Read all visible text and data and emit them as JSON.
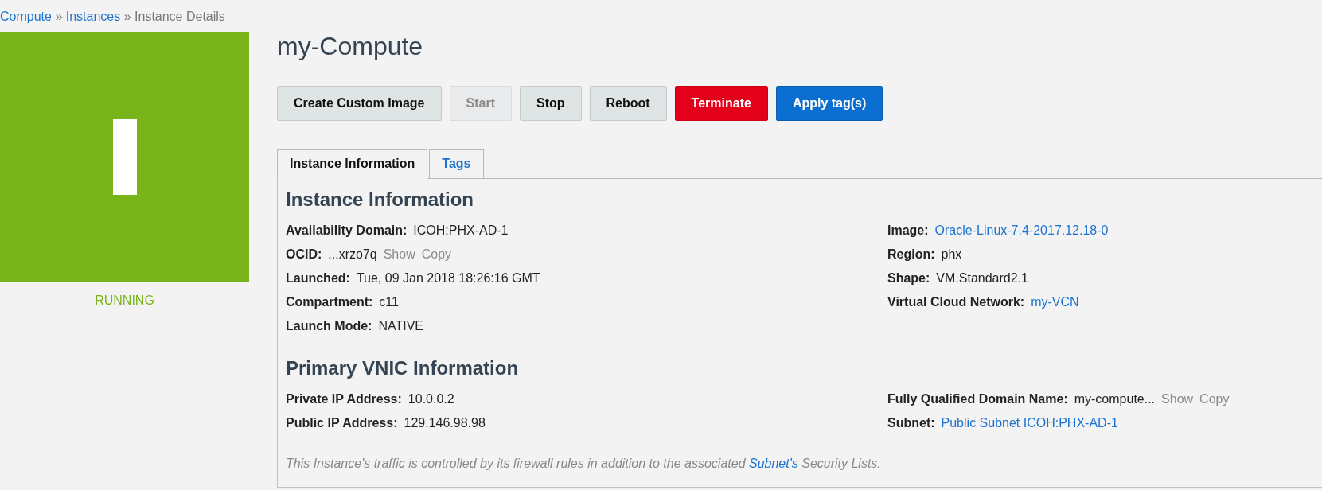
{
  "breadcrumb": {
    "separator": "»",
    "items": [
      {
        "label": "Compute",
        "kind": "link"
      },
      {
        "label": "Instances",
        "kind": "link"
      },
      {
        "label": "Instance Details",
        "kind": "current"
      }
    ]
  },
  "status": {
    "label": "RUNNING"
  },
  "title": "my-Compute",
  "buttons": [
    {
      "label": "Create Custom Image",
      "kind": "default",
      "disabled": false
    },
    {
      "label": "Start",
      "kind": "default",
      "disabled": true
    },
    {
      "label": "Stop",
      "kind": "default",
      "disabled": false
    },
    {
      "label": "Reboot",
      "kind": "default",
      "disabled": false
    },
    {
      "label": "Terminate",
      "kind": "danger",
      "disabled": false
    },
    {
      "label": "Apply tag(s)",
      "kind": "primary",
      "disabled": false
    }
  ],
  "tabs": [
    {
      "label": "Instance Information",
      "selected": true
    },
    {
      "label": "Tags",
      "selected": false
    }
  ],
  "sections": [
    {
      "heading": "Instance Information",
      "left": [
        {
          "label": "Availability Domain:",
          "value": "ICOH:PHX-AD-1",
          "kind": "text"
        },
        {
          "label": "OCID:",
          "value": "...xrzo7q",
          "kind": "secret",
          "actions": [
            "Show",
            "Copy"
          ]
        },
        {
          "label": "Launched:",
          "value": "Tue, 09 Jan 2018 18:26:16 GMT",
          "kind": "text"
        },
        {
          "label": "Compartment:",
          "value": "c11",
          "kind": "text"
        },
        {
          "label": "Launch Mode:",
          "value": "NATIVE",
          "kind": "text"
        }
      ],
      "right": [
        {
          "label": "Image:",
          "value": "Oracle-Linux-7.4-2017.12.18-0",
          "kind": "link"
        },
        {
          "label": "Region:",
          "value": "phx",
          "kind": "text"
        },
        {
          "label": "Shape:",
          "value": "VM.Standard2.1",
          "kind": "text"
        },
        {
          "label": "Virtual Cloud Network:",
          "value": "my-VCN",
          "kind": "link"
        }
      ]
    },
    {
      "heading": "Primary VNIC Information",
      "left": [
        {
          "label": "Private IP Address:",
          "value": "10.0.0.2",
          "kind": "text"
        },
        {
          "label": "Public IP Address:",
          "value": "129.146.98.98",
          "kind": "text"
        }
      ],
      "right": [
        {
          "label": "Fully Qualified Domain Name:",
          "value": "my-compute...",
          "kind": "secret",
          "actions": [
            "Show",
            "Copy"
          ]
        },
        {
          "label": "Subnet:",
          "value": "Public Subnet ICOH:PHX-AD-1",
          "kind": "link"
        }
      ]
    }
  ],
  "note": {
    "before": "This Instance's traffic is controlled by its firewall rules in addition to the associated",
    "link": "Subnet's",
    "after": "Security Lists."
  }
}
